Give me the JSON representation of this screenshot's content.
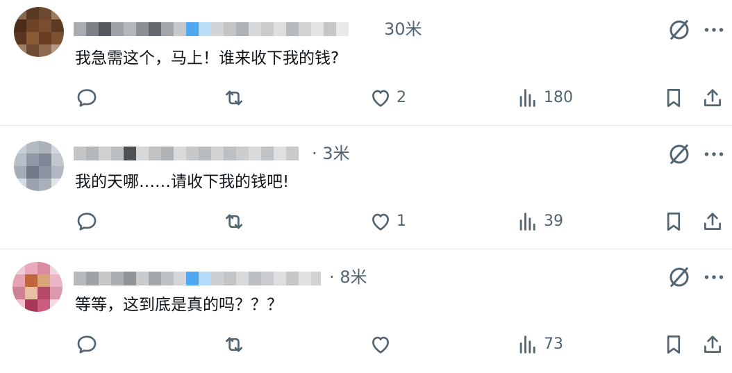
{
  "posts": [
    {
      "time": "30米",
      "text": "我急需这个，马上！谁来收下我的钱?",
      "reply_count": "",
      "repost_count": "",
      "like_count": "2",
      "view_count": "180"
    },
    {
      "time": "· 3米",
      "text": "我的天哪……请收下我的钱吧!",
      "reply_count": "",
      "repost_count": "",
      "like_count": "1",
      "view_count": "39"
    },
    {
      "time": "· 8米",
      "text": "等等，这到底是真的吗？？？",
      "reply_count": "",
      "repost_count": "",
      "like_count": "",
      "view_count": "73"
    }
  ],
  "icons": {
    "reply": "reply-icon",
    "repost": "repost-icon",
    "like": "heart-icon",
    "views": "views-icon",
    "bookmark": "bookmark-icon",
    "share": "share-icon",
    "grok": "grok-icon",
    "more": "more-icon"
  },
  "colors": {
    "text": "#0f1419",
    "muted": "#536471",
    "divider": "#e6e9ec"
  }
}
